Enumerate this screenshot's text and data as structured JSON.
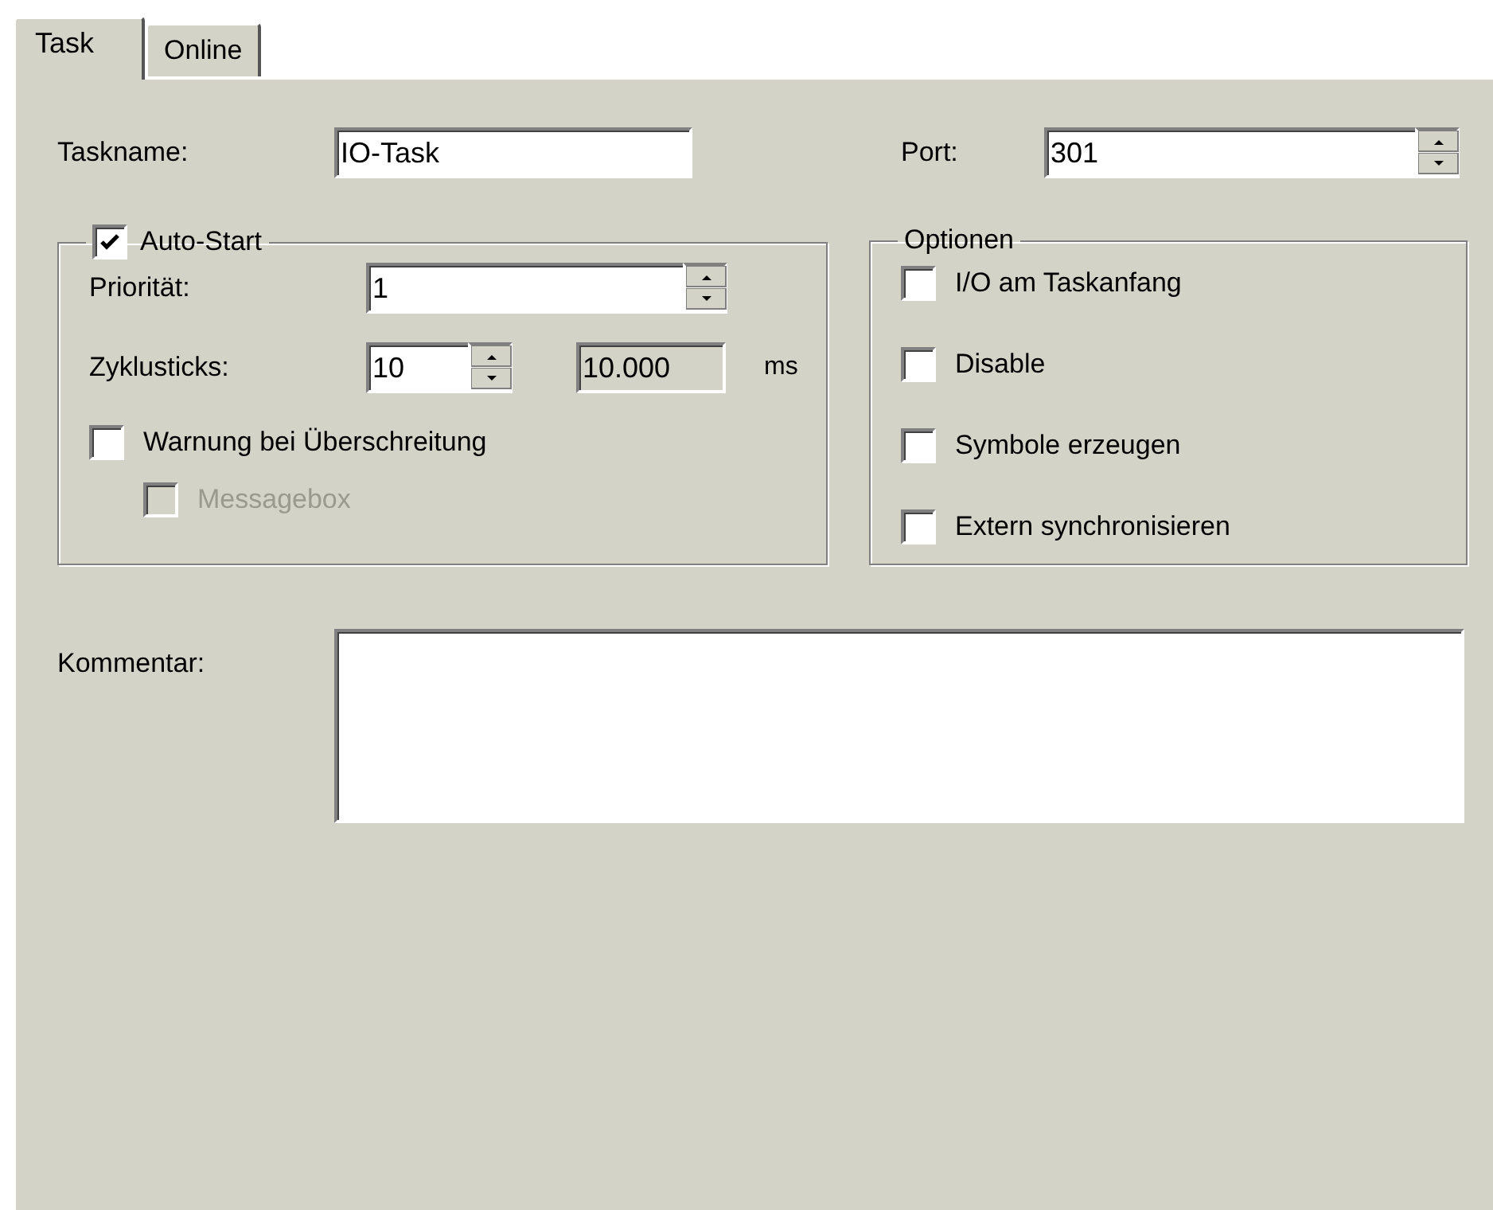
{
  "tabs": [
    {
      "label": "Task",
      "selected": true
    },
    {
      "label": "Online",
      "selected": false
    }
  ],
  "taskname": {
    "label": "Taskname:",
    "value": "IO-Task"
  },
  "port": {
    "label": "Port:",
    "value": "301"
  },
  "auto_start": {
    "label": "Auto-Start",
    "checked": true,
    "fields": [
      {
        "kind": "spin",
        "label": "Priorität:",
        "value": "1"
      },
      {
        "kind": "spin_readout",
        "label": "Zyklusticks:",
        "value": "10",
        "readout": "10.000",
        "unit": "ms"
      }
    ],
    "options": [
      {
        "label": "Warnung bei Überschreitung",
        "checked": false,
        "disabled": false,
        "children": [
          {
            "label": "Messagebox",
            "checked": false,
            "disabled": true
          }
        ]
      }
    ]
  },
  "optionen": {
    "title": "Optionen",
    "options": [
      {
        "label": "I/O am Taskanfang",
        "checked": false
      },
      {
        "label": "Disable",
        "checked": false
      },
      {
        "label": "Symbole erzeugen",
        "checked": false
      },
      {
        "label": "Extern synchronisieren",
        "checked": false
      }
    ]
  },
  "kommentar": {
    "label": "Kommentar:"
  }
}
